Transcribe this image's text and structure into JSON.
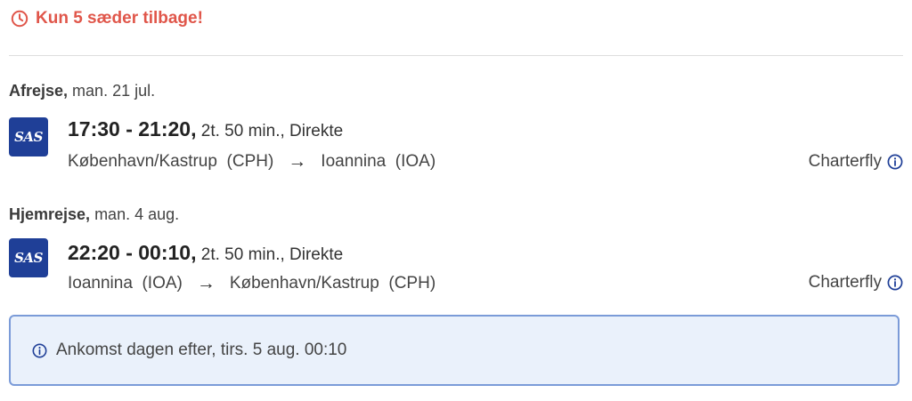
{
  "alert": {
    "text": "Kun 5 sæder tilbage!",
    "color": "#e0564a",
    "icon": "clock-icon"
  },
  "outbound": {
    "label": "Afrejse,",
    "date": " man. 21 jul.",
    "airline_logo": "SAS",
    "time_range": "17:30 - 21:20,",
    "duration": " 2t. 50 min., Direkte",
    "from": "København/Kastrup",
    "from_code": "(CPH)",
    "to": "Ioannina",
    "to_code": "(IOA)",
    "flight_type": "Charterfly",
    "info_icon": "info-icon"
  },
  "return": {
    "label": "Hjemrejse,",
    "date": " man. 4 aug.",
    "airline_logo": "SAS",
    "time_range": "22:20 - 00:10,",
    "duration": " 2t. 50 min., Direkte",
    "from": "Ioannina",
    "from_code": "(IOA)",
    "to": "København/Kastrup",
    "to_code": "(CPH)",
    "flight_type": "Charterfly",
    "info_icon": "info-icon"
  },
  "notice": {
    "text": "Ankomst dagen efter, tirs. 5 aug. 00:10",
    "border_color": "#7b9bd8",
    "background": "#eaf1fb",
    "icon": "info-icon"
  },
  "colors": {
    "logo_bg": "#1f3f97",
    "accent_blue": "#1f3f97"
  }
}
